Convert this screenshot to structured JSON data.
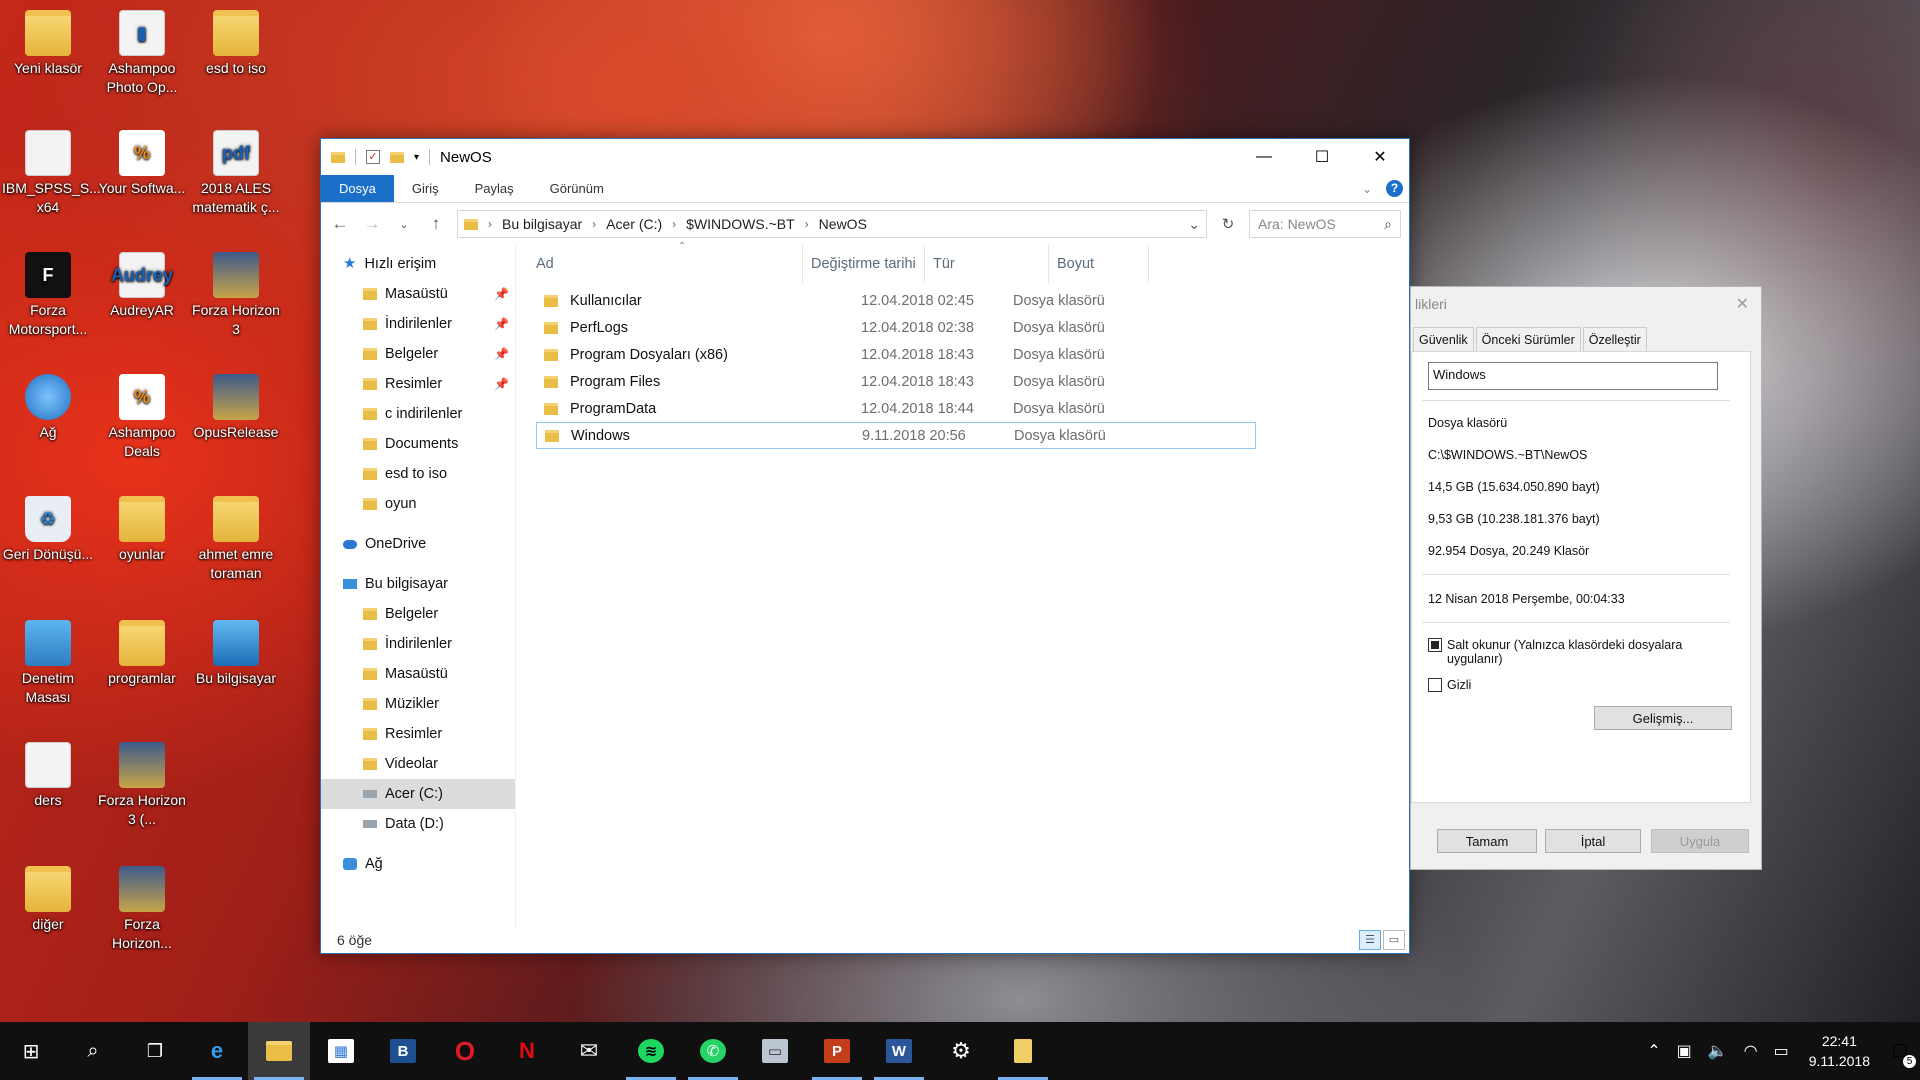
{
  "desktop": {
    "icons": [
      {
        "label": "Yeni klasör",
        "glyph": ""
      },
      {
        "label": "Ashampoo Photo Op...",
        "glyph": "▮"
      },
      {
        "label": "esd to iso",
        "glyph": ""
      },
      {
        "label": "IBM_SPSS_S... x64",
        "glyph": ""
      },
      {
        "label": "Your Softwa...",
        "glyph": "%"
      },
      {
        "label": "2018 ALES matematik ç...",
        "glyph": "pdf"
      },
      {
        "label": "Forza Motorsport...",
        "glyph": "F"
      },
      {
        "label": "AudreyAR",
        "glyph": "Audrey"
      },
      {
        "label": "Forza Horizon 3",
        "glyph": ""
      },
      {
        "label": "Ağ",
        "glyph": ""
      },
      {
        "label": "Ashampoo Deals",
        "glyph": "%"
      },
      {
        "label": "OpusRelease",
        "glyph": ""
      },
      {
        "label": "Geri Dönüşü...",
        "glyph": "♻"
      },
      {
        "label": "oyunlar",
        "glyph": ""
      },
      {
        "label": "ahmet emre toraman",
        "glyph": ""
      },
      {
        "label": "Denetim Masası",
        "glyph": ""
      },
      {
        "label": "programlar",
        "glyph": ""
      },
      {
        "label": "Bu bilgisayar",
        "glyph": ""
      },
      {
        "label": "ders",
        "glyph": ""
      },
      {
        "label": "Forza Horizon 3 (...",
        "glyph": ""
      },
      {
        "label": "diğer",
        "glyph": ""
      },
      {
        "label": "Forza Horizon...",
        "glyph": ""
      }
    ]
  },
  "explorer": {
    "title": "NewOS",
    "ribbon_tabs": [
      "Dosya",
      "Giriş",
      "Paylaş",
      "Görünüm"
    ],
    "address": [
      "Bu bilgisayar",
      "Acer (C:)",
      "$WINDOWS.~BT",
      "NewOS"
    ],
    "search_placeholder": "Ara: NewOS",
    "nav": {
      "quick_access": "Hızlı erişim",
      "quick_items": [
        "Masaüstü",
        "İndirilenler",
        "Belgeler",
        "Resimler",
        "c indirilenler",
        "Documents",
        "esd to iso",
        "oyun"
      ],
      "onedrive": "OneDrive",
      "this_pc": "Bu bilgisayar",
      "pc_items": [
        "Belgeler",
        "İndirilenler",
        "Masaüstü",
        "Müzikler",
        "Resimler",
        "Videolar",
        "Acer (C:)",
        "Data (D:)"
      ],
      "network": "Ağ"
    },
    "columns": [
      "Ad",
      "Değiştirme tarihi",
      "Tür",
      "Boyut"
    ],
    "files": [
      {
        "name": "Kullanıcılar",
        "date": "12.04.2018 02:45",
        "type": "Dosya klasörü"
      },
      {
        "name": "PerfLogs",
        "date": "12.04.2018 02:38",
        "type": "Dosya klasörü"
      },
      {
        "name": "Program Dosyaları (x86)",
        "date": "12.04.2018 18:43",
        "type": "Dosya klasörü"
      },
      {
        "name": "Program Files",
        "date": "12.04.2018 18:43",
        "type": "Dosya klasörü"
      },
      {
        "name": "ProgramData",
        "date": "12.04.2018 18:44",
        "type": "Dosya klasörü"
      },
      {
        "name": "Windows",
        "date": "9.11.2018 20:56",
        "type": "Dosya klasörü"
      }
    ],
    "status": "6 öğe"
  },
  "properties": {
    "title": "likleri",
    "tabs": [
      "Güvenlik",
      "Önceki Sürümler",
      "Özelleştir"
    ],
    "name": "Windows",
    "type": "Dosya klasörü",
    "location": "C:\\$WINDOWS.~BT\\NewOS",
    "size": "14,5 GB (15.634.050.890 bayt)",
    "size_on_disk": "9,53 GB (10.238.181.376 bayt)",
    "contains": "92.954 Dosya, 20.249 Klasör",
    "created": "12 Nisan 2018 Perşembe, 00:04:33",
    "readonly_label": "Salt okunur (Yalnızca klasördeki dosyalara uygulanır)",
    "hidden_label": "Gizli",
    "advanced_button": "Gelişmiş...",
    "ok_button": "Tamam",
    "cancel_button": "İptal",
    "apply_button": "Uygula"
  },
  "taskbar": {
    "apps": [
      "start",
      "search",
      "task-view",
      "edge",
      "file-explorer",
      "store",
      "b-app",
      "opera",
      "netflix",
      "mail",
      "spotify",
      "whatsapp",
      "network-app",
      "powerpoint",
      "word",
      "settings",
      "folder"
    ],
    "time": "22:41",
    "date": "9.11.2018",
    "notification_count": "5"
  }
}
